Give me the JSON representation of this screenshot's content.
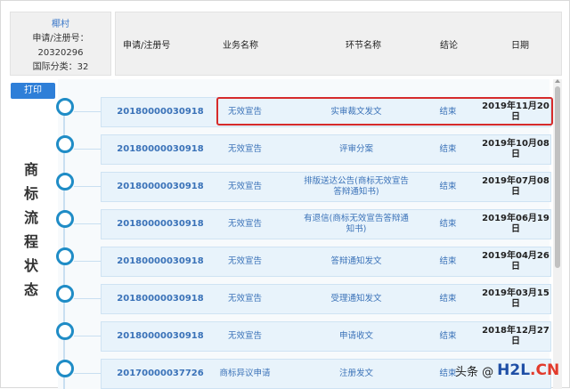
{
  "info": {
    "owner": "椰村",
    "reg_line": "申请/注册号：20320296",
    "class_line": "国际分类：32"
  },
  "columns": {
    "app_no": "申请/注册号",
    "business": "业务名称",
    "step": "环节名称",
    "result": "结论",
    "date": "日期"
  },
  "print_label": "打印",
  "side_label": [
    "商",
    "标",
    "流",
    "程",
    "状",
    "态"
  ],
  "rows": [
    {
      "app_no": "20180000030918",
      "business": "无效宣告",
      "step": "实审裁文发文",
      "result": "结束",
      "date": "2019年11月20日"
    },
    {
      "app_no": "20180000030918",
      "business": "无效宣告",
      "step": "评审分案",
      "result": "结束",
      "date": "2019年10月08日"
    },
    {
      "app_no": "20180000030918",
      "business": "无效宣告",
      "step": "排版送达公告(商标无效宣告答辩通知书)",
      "result": "结束",
      "date": "2019年07月08日"
    },
    {
      "app_no": "20180000030918",
      "business": "无效宣告",
      "step": "有退信(商标无效宣告答辩通知书)",
      "result": "结束",
      "date": "2019年06月19日"
    },
    {
      "app_no": "20180000030918",
      "business": "无效宣告",
      "step": "答辩通知发文",
      "result": "结束",
      "date": "2019年04月26日"
    },
    {
      "app_no": "20180000030918",
      "business": "无效宣告",
      "step": "受理通知发文",
      "result": "结束",
      "date": "2019年03月15日"
    },
    {
      "app_no": "20180000030918",
      "business": "无效宣告",
      "step": "申请收文",
      "result": "结束",
      "date": "2018年12月27日"
    },
    {
      "app_no": "20170000037726",
      "business": "商标异议申请",
      "step": "注册发文",
      "result": "结束",
      "date": ""
    }
  ],
  "watermark": {
    "prefix": "头条 @",
    "brand": "H2L",
    "suffix": ".CN"
  },
  "colors": {
    "accent": "#2f7fd8",
    "node": "#1f8cc6",
    "highlight": "#d62b2b",
    "row_bg": "#e8f3fb"
  }
}
